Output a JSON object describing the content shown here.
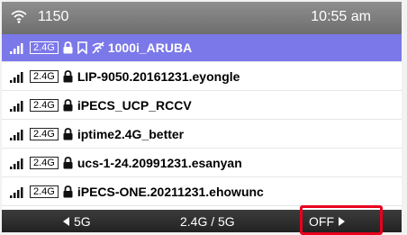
{
  "status": {
    "extension": "1150",
    "time": "10:55 am",
    "icon": "wifi-icon"
  },
  "networks": [
    {
      "band": "2.4G",
      "ssid": "1000i_ARUBA",
      "icons": [
        "lock-icon",
        "bookmark-icon",
        "wifi-off-icon"
      ],
      "selected": true
    },
    {
      "band": "2.4G",
      "ssid": "LIP-9050.20161231.eyongle",
      "icons": [
        "lock-icon"
      ],
      "selected": false
    },
    {
      "band": "2.4G",
      "ssid": "iPECS_UCP_RCCV",
      "icons": [
        "lock-icon"
      ],
      "selected": false
    },
    {
      "band": "2.4G",
      "ssid": "iptime2.4G_better",
      "icons": [
        "lock-icon"
      ],
      "selected": false
    },
    {
      "band": "2.4G",
      "ssid": "ucs-1-24.20991231.esanyan",
      "icons": [
        "lock-icon"
      ],
      "selected": false
    },
    {
      "band": "2.4G",
      "ssid": "iPECS-ONE.20211231.ehowunc",
      "icons": [
        "lock-icon"
      ],
      "selected": false
    }
  ],
  "softkeys": {
    "left": "5G",
    "middle": "2.4G / 5G",
    "right": "OFF"
  },
  "colors": {
    "selected_row": "#7b78e9",
    "highlight": "#e8001c"
  }
}
